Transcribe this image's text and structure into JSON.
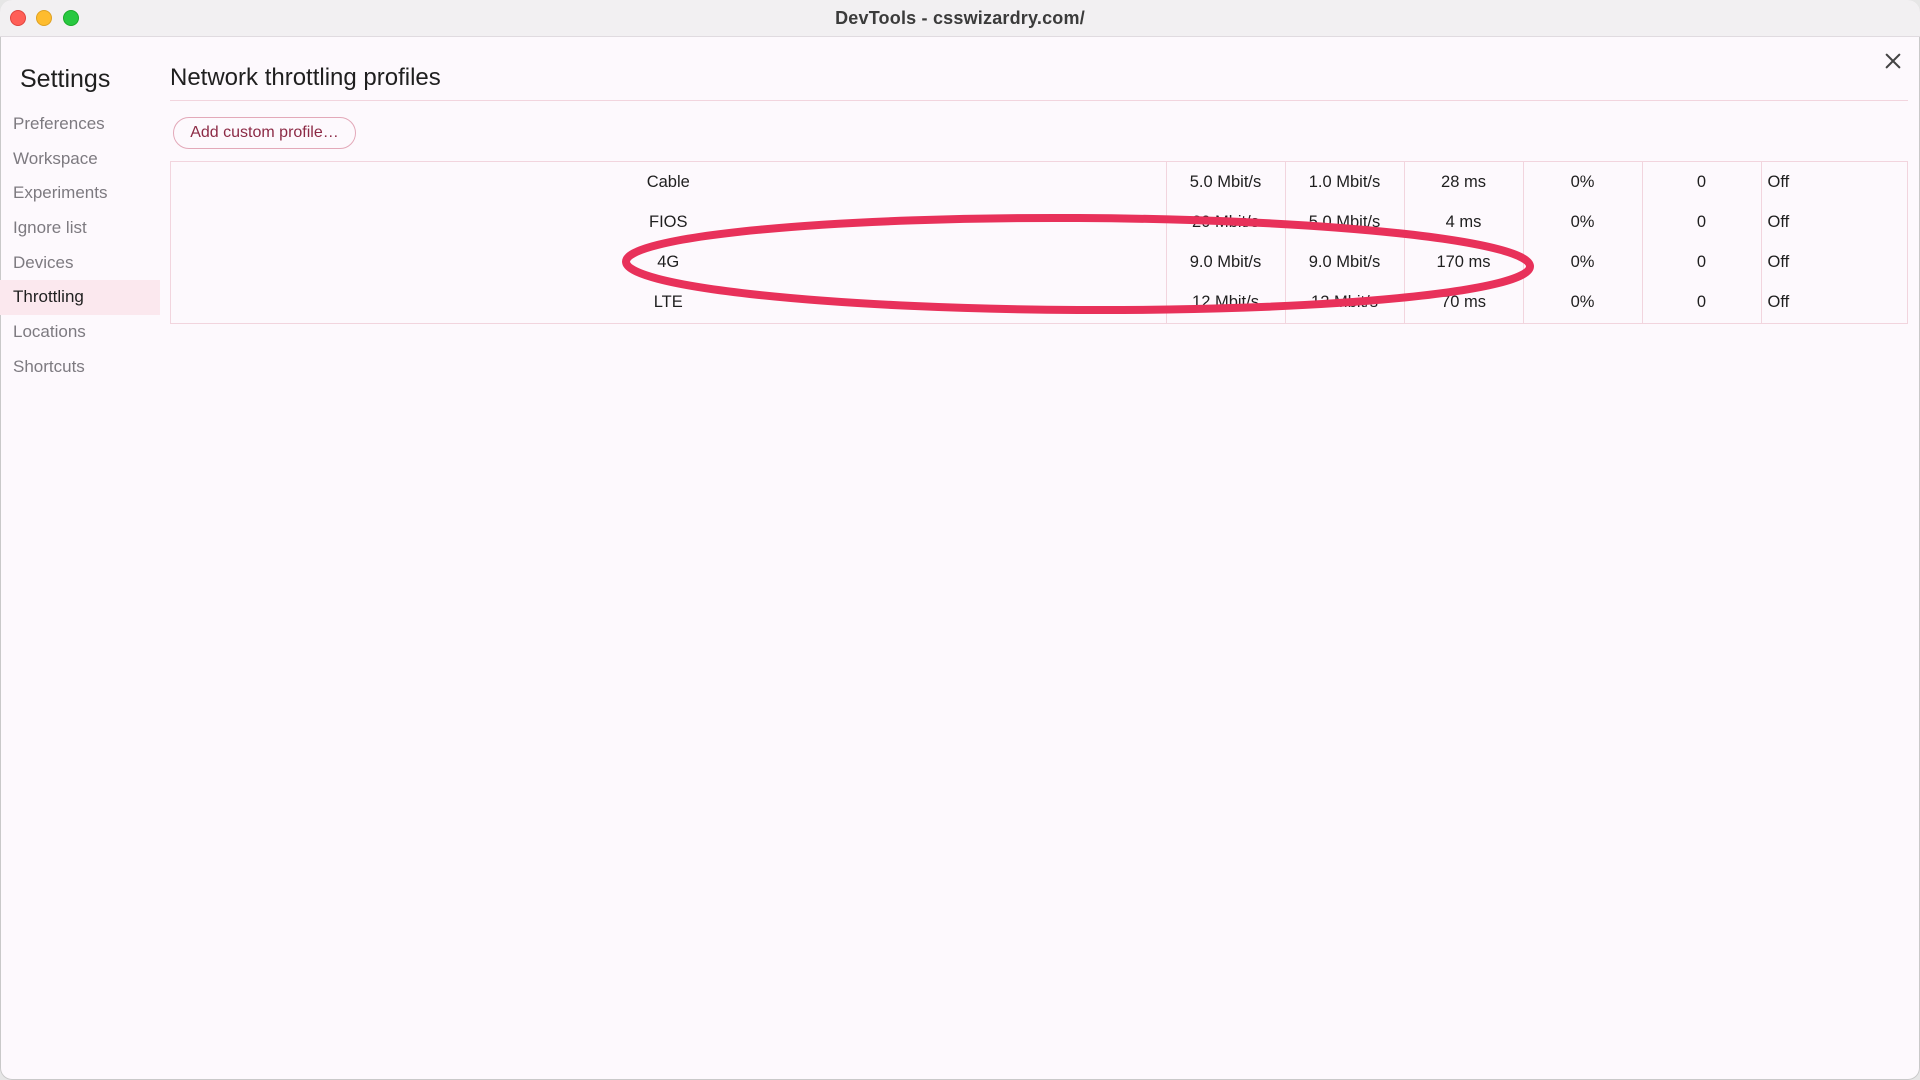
{
  "window": {
    "title": "DevTools - csswizardry.com/"
  },
  "colors": {
    "accent": "#8c2a45",
    "annotation": "#e8315a",
    "selected_bg": "#fbe8ee"
  },
  "sidebar": {
    "title": "Settings",
    "items": [
      {
        "label": "Preferences"
      },
      {
        "label": "Workspace"
      },
      {
        "label": "Experiments"
      },
      {
        "label": "Ignore list"
      },
      {
        "label": "Devices"
      },
      {
        "label": "Throttling",
        "selected": true
      },
      {
        "label": "Locations"
      },
      {
        "label": "Shortcuts"
      }
    ]
  },
  "main": {
    "title": "Network throttling profiles",
    "add_button_label": "Add custom profile…",
    "profiles": [
      {
        "name": "Cable",
        "download": "5.0 Mbit/s",
        "upload": "1.0 Mbit/s",
        "latency": "28 ms",
        "packet_loss": "0%",
        "packet_queue": "0",
        "status": "Off"
      },
      {
        "name": "FIOS",
        "download": "20 Mbit/s",
        "upload": "5.0 Mbit/s",
        "latency": "4 ms",
        "packet_loss": "0%",
        "packet_queue": "0",
        "status": "Off"
      },
      {
        "name": "4G",
        "download": "9.0 Mbit/s",
        "upload": "9.0 Mbit/s",
        "latency": "170 ms",
        "packet_loss": "0%",
        "packet_queue": "0",
        "status": "Off"
      },
      {
        "name": "LTE",
        "download": "12 Mbit/s",
        "upload": "12 Mbit/s",
        "latency": "70 ms",
        "packet_loss": "0%",
        "packet_queue": "0",
        "status": "Off"
      }
    ]
  }
}
